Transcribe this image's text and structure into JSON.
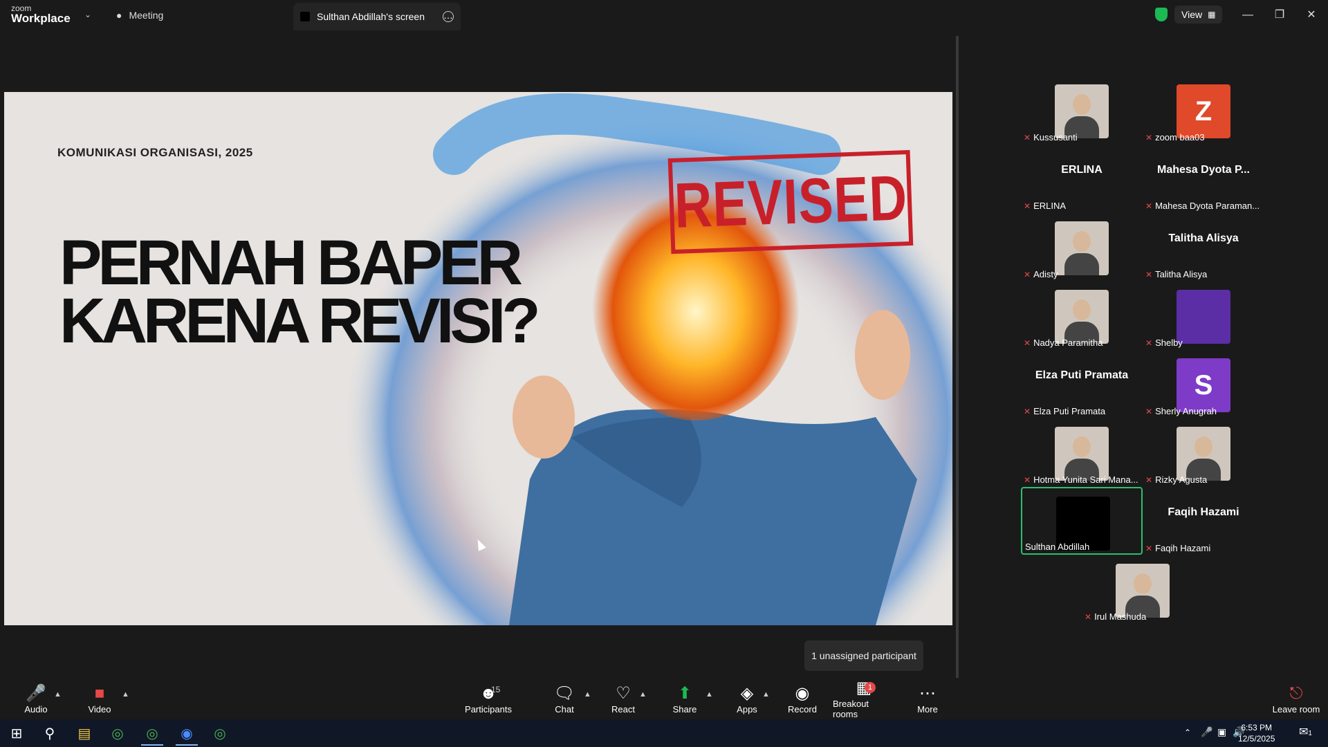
{
  "titlebar": {
    "logo_top": "zoom",
    "logo_bottom": "Workplace",
    "tab_meeting": "Meeting",
    "tab_screen": "Sulthan Abdillah's screen",
    "view_label": "View"
  },
  "slide": {
    "kicker": "KOMUNIKASI ORGANISASI, 2025",
    "title_line1": "PERNAH BAPER",
    "title_line2": "KARENA REVISI?",
    "stamp": "REVISED"
  },
  "participants": [
    {
      "name": "Kussusanti",
      "type": "photo"
    },
    {
      "name": "zoom baa03",
      "type": "letter",
      "letter": "Z",
      "color": "#e0492a"
    },
    {
      "name": "ERLINA",
      "type": "name",
      "display": "ERLINA"
    },
    {
      "name": "Mahesa Dyota Paraman...",
      "type": "name",
      "display": "Mahesa Dyota P..."
    },
    {
      "name": "Adisty",
      "type": "photo"
    },
    {
      "name": "Talitha Alisya",
      "type": "name",
      "display": "Talitha Alisya"
    },
    {
      "name": "Nadya Paramitha",
      "type": "photo"
    },
    {
      "name": "Shelby",
      "type": "letter",
      "letter": "",
      "color": "#5b2ea6"
    },
    {
      "name": "Elza Puti Pramata",
      "type": "name",
      "display": "Elza Puti Pramata"
    },
    {
      "name": "Sherly Anugrah",
      "type": "letter",
      "letter": "S",
      "color": "#7d3bc8"
    },
    {
      "name": "Hotma Yunita Sari Mana...",
      "type": "photo"
    },
    {
      "name": "Rizky Agusta",
      "type": "photo"
    },
    {
      "name": "Sulthan Abdillah",
      "type": "dark"
    },
    {
      "name": "Faqih Hazami",
      "type": "name",
      "display": "Faqih Hazami"
    },
    {
      "name": "Irul Mashuda",
      "type": "photo"
    }
  ],
  "tooltip": "1 unassigned participant",
  "toolbar": {
    "audio": "Audio",
    "video": "Video",
    "participants": "Participants",
    "participants_count": "15",
    "chat": "Chat",
    "react": "React",
    "share": "Share",
    "apps": "Apps",
    "record": "Record",
    "breakout": "Breakout rooms",
    "breakout_badge": "1",
    "more": "More",
    "leave": "Leave room"
  },
  "taskbar": {
    "time": "6:53 PM",
    "date": "12/5/2025",
    "notif_count": "1"
  },
  "colors": {
    "accent_green": "#1db954",
    "mute_red": "#e54848",
    "active_tile_border": "#2fbf71",
    "stamp_red": "#c8202a"
  }
}
